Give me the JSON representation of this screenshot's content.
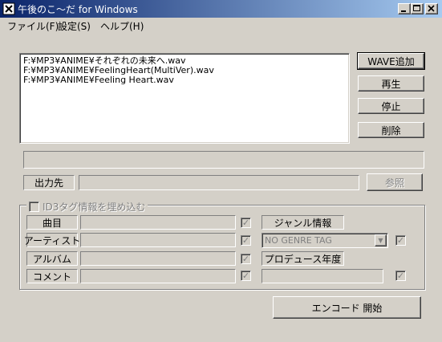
{
  "window": {
    "title": "午後のこ～だ for Windows"
  },
  "menu": [
    "ファイル(F)",
    "設定(S)",
    "ヘルプ(H)"
  ],
  "files": [
    "F:¥MP3¥ANIME¥それぞれの未来へ.wav",
    "F:¥MP3¥ANIME¥FeelingHeart(MultiVer).wav",
    "F:¥MP3¥ANIME¥Feeling Heart.wav"
  ],
  "buttons": {
    "add_wave": "WAVE追加",
    "play": "再生",
    "stop": "停止",
    "delete": "削除",
    "browse": "参照",
    "encode": "エンコード 開始"
  },
  "output": {
    "label": "出力先",
    "value": ""
  },
  "id3": {
    "group_label": "ID3タグ情報を埋め込む",
    "check_mark": "✓",
    "fields": [
      {
        "label": "曲目",
        "value": ""
      },
      {
        "label": "アーティスト",
        "value": ""
      },
      {
        "label": "アルバム",
        "value": ""
      },
      {
        "label": "コメント",
        "value": ""
      }
    ],
    "genre_label": "ジャンル情報",
    "genre_value": "NO GENRE TAG",
    "year_label": "プロデュース年度",
    "year_value": ""
  }
}
